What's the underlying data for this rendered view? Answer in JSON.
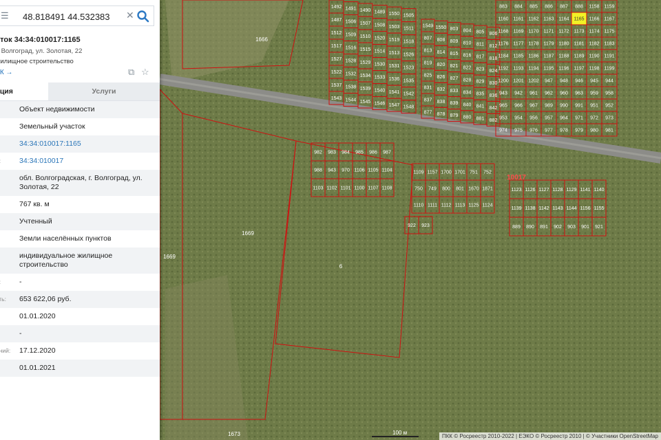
{
  "search": {
    "value": "48.818491 44.532383",
    "clear_icon": "close-icon",
    "search_icon": "search-icon"
  },
  "panel": {
    "title": "сток 34:34:010017:1165",
    "address": "г. Волгоград, ул. Золотая, 22",
    "purpose": "жилищное строительство",
    "kk_link": "КК →",
    "tabs": [
      "ация",
      "Услуги"
    ],
    "rows": [
      {
        "label": "",
        "value": "Объект недвижимости"
      },
      {
        "label": "",
        "value": "Земельный участок"
      },
      {
        "label": "",
        "value": "34:34:010017:1165",
        "link": true
      },
      {
        "label": "р:",
        "value": "34:34:010017",
        "link": true
      },
      {
        "label": "",
        "value": "обл. Волгоградская, г. Волгоград, ул. Золотая, 22"
      },
      {
        "label": "ь:",
        "value": "767 кв. м"
      },
      {
        "label": "",
        "value": "Учтенный"
      },
      {
        "label": "",
        "value": "Земли населённых пунктов"
      },
      {
        "label": "",
        "value": "индивидуальное жилищное строительство"
      },
      {
        "label": "и:",
        "value": "-"
      },
      {
        "label": "сть:",
        "value": "653 622,06 руб."
      },
      {
        "label": "",
        "value": "01.01.2020"
      },
      {
        "label": "",
        "value": "-"
      },
      {
        "label": "ений:",
        "value": "17.12.2020"
      },
      {
        "label": "",
        "value": "01.01.2021"
      }
    ]
  },
  "map": {
    "quarter_label": "10017",
    "highlight_parcel": "1165",
    "big_parcels": [
      "1666",
      "1669",
      "1669",
      "6",
      "1673"
    ],
    "parcel_numbers": [
      "1492",
      "1491",
      "1490",
      "1489",
      "1550",
      "1505",
      "1487",
      "1506",
      "1507",
      "1508",
      "1503",
      "1511",
      "1512",
      "1509",
      "1510",
      "1520",
      "1519",
      "1518",
      "1517",
      "1516",
      "1515",
      "1514",
      "1513",
      "1526",
      "1527",
      "1528",
      "1529",
      "1530",
      "1531",
      "1523",
      "1522",
      "1532",
      "1534",
      "1533",
      "1536",
      "1535",
      "1537",
      "1538",
      "1539",
      "1540",
      "1541",
      "1542",
      "1543",
      "1544",
      "1545",
      "1546",
      "1547",
      "1548",
      "1549",
      "1550",
      "803",
      "804",
      "805",
      "806",
      "807",
      "808",
      "809",
      "810",
      "811",
      "812",
      "813",
      "814",
      "815",
      "816",
      "817",
      "818",
      "819",
      "820",
      "821",
      "822",
      "823",
      "824",
      "825",
      "826",
      "827",
      "828",
      "829",
      "830",
      "831",
      "832",
      "833",
      "834",
      "835",
      "836",
      "837",
      "838",
      "839",
      "840",
      "841",
      "842",
      "877",
      "878",
      "879",
      "880",
      "881",
      "882",
      "883",
      "884",
      "885",
      "886",
      "887",
      "888",
      "1158",
      "1159",
      "1160",
      "1161",
      "1162",
      "1163",
      "1164",
      "1165",
      "1166",
      "1167",
      "1168",
      "1169",
      "1170",
      "1171",
      "1172",
      "1173",
      "1174",
      "1175",
      "1176",
      "1177",
      "1178",
      "1179",
      "1180",
      "1181",
      "1182",
      "1183",
      "1184",
      "1185",
      "1186",
      "1187",
      "1188",
      "1189",
      "1190",
      "1191",
      "1192",
      "1193",
      "1194",
      "1195",
      "1196",
      "1197",
      "1198",
      "1199",
      "1200",
      "1201",
      "1202",
      "947",
      "948",
      "946",
      "945",
      "944",
      "943",
      "942",
      "961",
      "962",
      "960",
      "963",
      "959",
      "958",
      "965",
      "966",
      "967",
      "989",
      "990",
      "991",
      "951",
      "952",
      "953",
      "954",
      "956",
      "957",
      "964",
      "971",
      "972",
      "973",
      "974",
      "975",
      "976",
      "977",
      "978",
      "979",
      "980",
      "981",
      "982",
      "983",
      "984",
      "985",
      "986",
      "987",
      "988",
      "943",
      "970",
      "1106",
      "1105",
      "1104",
      "1103",
      "1102",
      "1101",
      "1100",
      "1107",
      "1108",
      "1109",
      "1157",
      "1700",
      "1701",
      "751",
      "752",
      "750",
      "749",
      "800",
      "801",
      "1670",
      "1871",
      "1110",
      "1111",
      "1112",
      "1113",
      "1125",
      "1124",
      "1123",
      "1126",
      "1127",
      "1128",
      "1129",
      "1141",
      "1140",
      "1139",
      "1138",
      "1142",
      "1143",
      "1144",
      "1156",
      "1155",
      "889",
      "890",
      "891",
      "902",
      "903",
      "901",
      "921",
      "922",
      "923"
    ]
  },
  "scale": {
    "label": "100 м"
  },
  "attribution": "ПКК © Росреестр 2010-2022 | ЕЭКО © Росреестр 2010 | © Участники OpenStreetMap",
  "colors": {
    "accent": "#2c79c4",
    "parcel_border": "#d01010",
    "highlight": "#f2f226",
    "road": "#8c8c88"
  }
}
